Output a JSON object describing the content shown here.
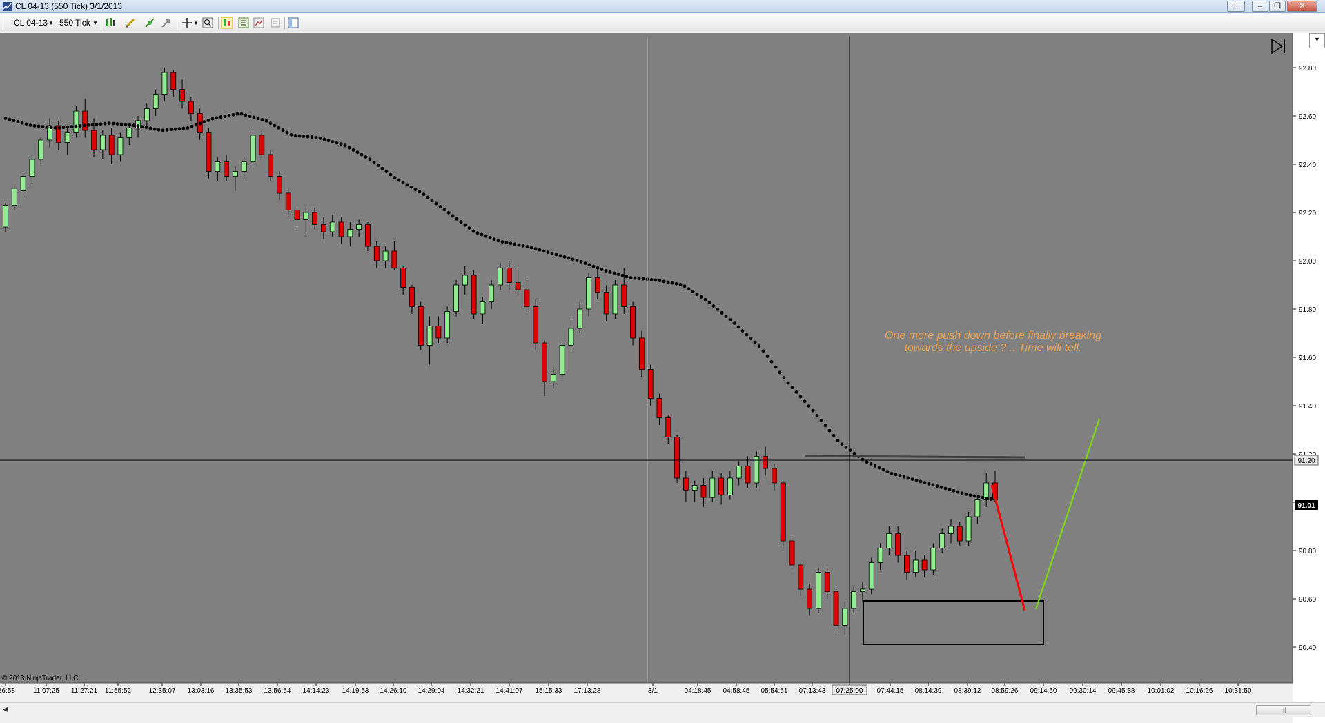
{
  "window": {
    "title": "CL 04-13 (550 Tick)  3/1/2013",
    "buttons": [
      "L",
      "–",
      "❐",
      "✕"
    ]
  },
  "toolbar": {
    "instrument": "CL 04-13",
    "interval": "550 Tick"
  },
  "chart": {
    "copyright": "© 2013 NinjaTrader, LLC",
    "annotation_line1": "One more push down before finally breaking",
    "annotation_line2": "towards the upside ? .. Time will tell.",
    "annotation_color": "#e8a050",
    "price_ticks": [
      "92.80",
      "92.60",
      "92.40",
      "92.20",
      "92.00",
      "91.80",
      "91.60",
      "91.40",
      "91.20",
      "91.00",
      "90.80",
      "90.60",
      "90.40"
    ],
    "crosshair_price": "91.20",
    "last_price": "91.01",
    "time_labels": [
      ":56:58",
      "11:07:25",
      "11:27:21",
      "11:55:52",
      "12:35:07",
      "13:03:16",
      "13:35:53",
      "13:56:54",
      "14:14:23",
      "14:19:53",
      "14:26:10",
      "14:29:04",
      "14:32:21",
      "14:41:07",
      "15:15:33",
      "17:13:28",
      "3/1",
      "04:18:45",
      "04:58:45",
      "05:54:51",
      "07:13:43",
      "07:25:00",
      "07:44:15",
      "08:14:39",
      "08:39:12",
      "08:59:26",
      "09:14:50",
      "09:30:14",
      "09:45:38",
      "10:01:02",
      "10:16:26",
      "10:31:50"
    ],
    "crosshair_time": "07:25:00",
    "up_color": "#90ee90",
    "down_color": "#e00000",
    "background": "#808080"
  },
  "chart_data": {
    "type": "candlestick",
    "ylim": [
      90.3,
      92.9
    ],
    "candles": [
      [
        92.14,
        92.24,
        92.12,
        92.23
      ],
      [
        92.23,
        92.31,
        92.21,
        92.3
      ],
      [
        92.29,
        92.37,
        92.27,
        92.35
      ],
      [
        92.35,
        92.44,
        92.32,
        92.42
      ],
      [
        92.42,
        92.51,
        92.4,
        92.5
      ],
      [
        92.5,
        92.59,
        92.47,
        92.56
      ],
      [
        92.56,
        92.58,
        92.46,
        92.49
      ],
      [
        92.49,
        92.55,
        92.44,
        92.53
      ],
      [
        92.53,
        92.64,
        92.51,
        92.62
      ],
      [
        92.62,
        92.67,
        92.51,
        92.54
      ],
      [
        92.54,
        92.59,
        92.43,
        92.46
      ],
      [
        92.46,
        92.54,
        92.42,
        92.52
      ],
      [
        92.52,
        92.55,
        92.4,
        92.44
      ],
      [
        92.44,
        92.53,
        92.41,
        92.51
      ],
      [
        92.51,
        92.57,
        92.48,
        92.55
      ],
      [
        92.55,
        92.6,
        92.51,
        92.58
      ],
      [
        92.58,
        92.65,
        92.55,
        92.63
      ],
      [
        92.63,
        92.71,
        92.6,
        92.69
      ],
      [
        92.69,
        92.8,
        92.66,
        92.78
      ],
      [
        92.78,
        92.79,
        92.68,
        92.71
      ],
      [
        92.71,
        92.75,
        92.63,
        92.66
      ],
      [
        92.66,
        92.68,
        92.58,
        92.61
      ],
      [
        92.61,
        92.63,
        92.5,
        92.53
      ],
      [
        92.53,
        92.55,
        92.34,
        92.37
      ],
      [
        92.37,
        92.43,
        92.33,
        92.41
      ],
      [
        92.41,
        92.44,
        92.33,
        92.35
      ],
      [
        92.35,
        92.39,
        92.29,
        92.37
      ],
      [
        92.37,
        92.43,
        92.34,
        92.41
      ],
      [
        92.41,
        92.54,
        92.39,
        92.52
      ],
      [
        92.52,
        92.54,
        92.42,
        92.44
      ],
      [
        92.44,
        92.46,
        92.33,
        92.35
      ],
      [
        92.35,
        92.37,
        92.25,
        92.28
      ],
      [
        92.28,
        92.3,
        92.18,
        92.21
      ],
      [
        92.21,
        92.23,
        92.14,
        92.17
      ],
      [
        92.17,
        92.23,
        92.1,
        92.2
      ],
      [
        92.2,
        92.22,
        92.13,
        92.15
      ],
      [
        92.15,
        92.18,
        92.09,
        92.12
      ],
      [
        92.12,
        92.19,
        92.1,
        92.16
      ],
      [
        92.16,
        92.18,
        92.07,
        92.1
      ],
      [
        92.1,
        92.16,
        92.06,
        92.13
      ],
      [
        92.13,
        92.17,
        92.1,
        92.15
      ],
      [
        92.15,
        92.16,
        92.04,
        92.06
      ],
      [
        92.06,
        92.08,
        91.97,
        92.0
      ],
      [
        92.0,
        92.06,
        91.97,
        92.04
      ],
      [
        92.04,
        92.08,
        91.96,
        91.97
      ],
      [
        91.97,
        91.98,
        91.86,
        91.89
      ],
      [
        91.89,
        91.9,
        91.78,
        91.81
      ],
      [
        91.81,
        91.83,
        91.63,
        91.65
      ],
      [
        91.65,
        91.77,
        91.57,
        91.73
      ],
      [
        91.73,
        91.77,
        91.66,
        91.68
      ],
      [
        91.68,
        91.81,
        91.66,
        91.79
      ],
      [
        91.79,
        91.92,
        91.77,
        91.9
      ],
      [
        91.9,
        91.98,
        91.86,
        91.94
      ],
      [
        91.94,
        91.96,
        91.76,
        91.78
      ],
      [
        91.78,
        91.85,
        91.74,
        91.83
      ],
      [
        91.83,
        91.92,
        91.8,
        91.9
      ],
      [
        91.9,
        91.99,
        91.88,
        91.97
      ],
      [
        91.97,
        92.0,
        91.88,
        91.91
      ],
      [
        91.91,
        91.98,
        91.86,
        91.88
      ],
      [
        91.88,
        91.92,
        91.78,
        91.81
      ],
      [
        91.81,
        91.84,
        91.63,
        91.66
      ],
      [
        91.66,
        91.67,
        91.44,
        91.5
      ],
      [
        91.5,
        91.56,
        91.47,
        91.53
      ],
      [
        91.53,
        91.67,
        91.51,
        91.65
      ],
      [
        91.65,
        91.76,
        91.62,
        91.72
      ],
      [
        91.72,
        91.83,
        91.7,
        91.8
      ],
      [
        91.8,
        91.95,
        91.77,
        91.93
      ],
      [
        91.93,
        91.96,
        91.84,
        91.87
      ],
      [
        91.87,
        91.9,
        91.75,
        91.78
      ],
      [
        91.78,
        91.92,
        91.76,
        91.9
      ],
      [
        91.9,
        91.97,
        91.78,
        91.81
      ],
      [
        91.81,
        91.83,
        91.65,
        91.68
      ],
      [
        91.68,
        91.71,
        91.52,
        91.55
      ],
      [
        91.55,
        91.57,
        91.4,
        91.43
      ],
      [
        91.43,
        91.45,
        91.32,
        91.35
      ],
      [
        91.35,
        91.36,
        91.24,
        91.27
      ],
      [
        91.27,
        91.28,
        91.08,
        91.1
      ],
      [
        91.1,
        91.13,
        91.0,
        91.05
      ],
      [
        91.05,
        91.09,
        91.0,
        91.07
      ],
      [
        91.07,
        91.1,
        90.98,
        91.02
      ],
      [
        91.02,
        91.13,
        91.0,
        91.1
      ],
      [
        91.1,
        91.12,
        90.99,
        91.03
      ],
      [
        91.03,
        91.13,
        91.01,
        91.1
      ],
      [
        91.1,
        91.17,
        91.07,
        91.15
      ],
      [
        91.15,
        91.19,
        91.06,
        91.08
      ],
      [
        91.08,
        91.21,
        91.06,
        91.19
      ],
      [
        91.19,
        91.23,
        91.11,
        91.14
      ],
      [
        91.14,
        91.16,
        91.05,
        91.08
      ],
      [
        91.08,
        91.09,
        90.81,
        90.84
      ],
      [
        90.84,
        90.86,
        90.71,
        90.74
      ],
      [
        90.74,
        90.75,
        90.61,
        90.64
      ],
      [
        90.64,
        90.66,
        90.53,
        90.56
      ],
      [
        90.56,
        90.73,
        90.54,
        90.71
      ],
      [
        90.71,
        90.73,
        90.6,
        90.63
      ],
      [
        90.63,
        90.64,
        90.46,
        90.49
      ],
      [
        90.49,
        90.59,
        90.45,
        90.56
      ],
      [
        90.56,
        90.65,
        90.54,
        90.63
      ],
      [
        90.63,
        90.67,
        90.59,
        90.64
      ],
      [
        90.64,
        90.77,
        90.62,
        90.75
      ],
      [
        90.75,
        90.83,
        90.72,
        90.81
      ],
      [
        90.81,
        90.9,
        90.78,
        90.87
      ],
      [
        90.87,
        90.9,
        90.75,
        90.78
      ],
      [
        90.78,
        90.8,
        90.68,
        90.71
      ],
      [
        90.71,
        90.8,
        90.69,
        90.76
      ],
      [
        90.76,
        90.78,
        90.69,
        90.72
      ],
      [
        90.72,
        90.83,
        90.7,
        90.81
      ],
      [
        90.81,
        90.89,
        90.79,
        90.87
      ],
      [
        90.87,
        90.93,
        90.83,
        90.9
      ],
      [
        90.9,
        90.92,
        90.82,
        90.84
      ],
      [
        90.84,
        90.96,
        90.82,
        90.94
      ],
      [
        90.94,
        91.03,
        90.91,
        91.01
      ],
      [
        91.01,
        91.12,
        90.98,
        91.08
      ],
      [
        91.08,
        91.13,
        91.0,
        91.01
      ]
    ],
    "sma_dots": [
      92.59,
      92.56,
      92.55,
      92.56,
      92.57,
      92.56,
      92.54,
      92.55,
      92.59,
      92.61,
      92.58,
      92.52,
      92.51,
      92.48,
      92.42,
      92.34,
      92.28,
      92.2,
      92.12,
      92.08,
      92.06,
      92.03,
      92.0,
      91.96,
      91.93,
      91.92,
      91.9,
      91.83,
      91.74,
      91.64,
      91.5,
      91.38,
      91.25,
      91.17,
      91.12,
      91.09,
      91.06,
      91.03,
      91.01
    ],
    "sma_color": "#000000"
  }
}
